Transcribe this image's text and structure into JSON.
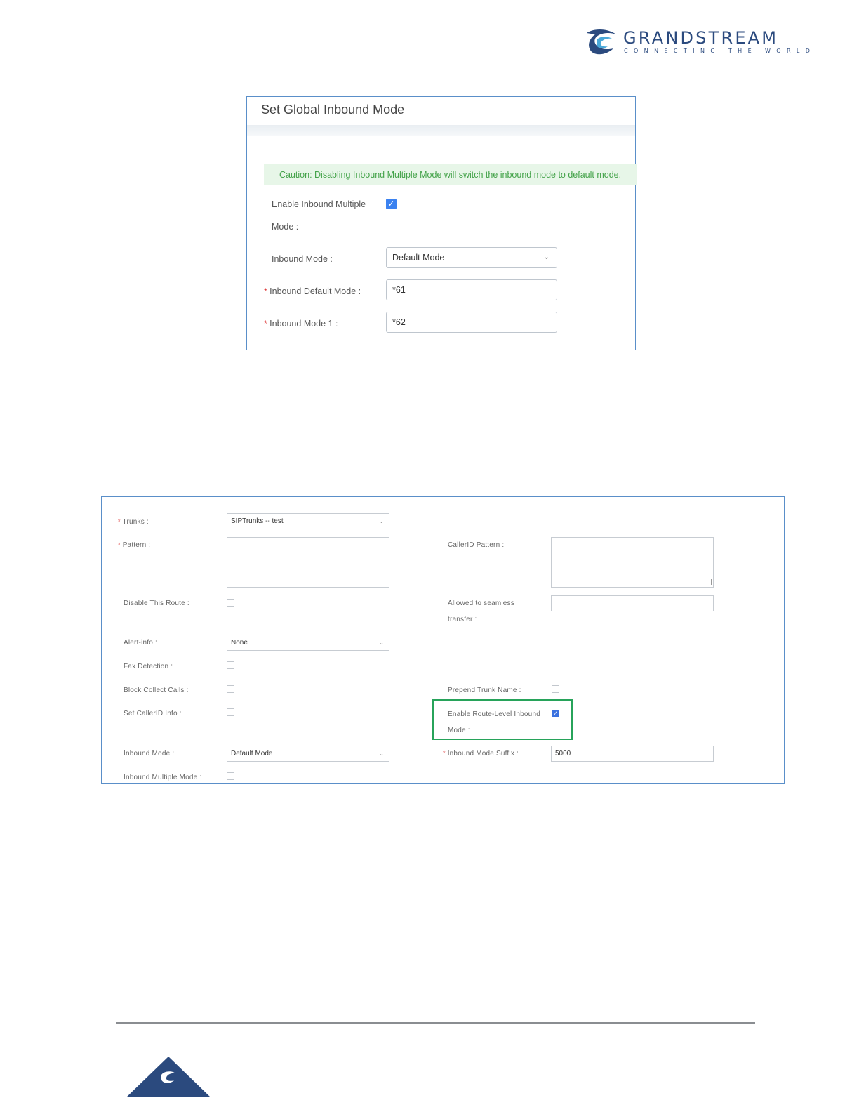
{
  "logo": {
    "name": "GRANDSTREAM",
    "tagline": "CONNECTING THE WORLD",
    "brand_color": "#2b4a7e"
  },
  "global_inbound": {
    "title": "Set Global Inbound Mode",
    "caution": "Caution: Disabling Inbound Multiple Mode will switch the inbound mode to default mode.",
    "enable_multiple_label_line1": "Enable Inbound Multiple",
    "enable_multiple_label_line2": "Mode :",
    "enable_multiple_checked": true,
    "inbound_mode_label": "Inbound Mode :",
    "inbound_mode_value": "Default Mode",
    "default_mode_label": "Inbound Default Mode :",
    "default_mode_value": "*61",
    "mode1_label": "Inbound Mode 1 :",
    "mode1_value": "*62",
    "required_mark": "*"
  },
  "route_form": {
    "required_mark": "*",
    "trunks_label": "Trunks :",
    "trunks_value": "SIPTrunks -- test",
    "pattern_label": "Pattern :",
    "callerid_pattern_label": "CallerID Pattern :",
    "disable_route_label": "Disable This Route :",
    "allowed_seamless_label_line1": "Allowed to seamless",
    "allowed_seamless_label_line2": "transfer :",
    "alert_info_label": "Alert-info :",
    "alert_info_value": "None",
    "fax_detection_label": "Fax Detection :",
    "block_collect_label": "Block Collect Calls :",
    "prepend_trunk_label": "Prepend Trunk Name :",
    "set_callerid_label": "Set CallerID Info :",
    "enable_route_level_line1": "Enable Route-Level Inbound",
    "enable_route_level_line2": "Mode :",
    "enable_route_level_checked": true,
    "inbound_mode_label": "Inbound Mode :",
    "inbound_mode_value": "Default Mode",
    "inbound_mode_suffix_label": "Inbound Mode Suffix :",
    "inbound_mode_suffix_value": "5000",
    "inbound_multiple_label": "Inbound Multiple Mode :",
    "highlight_color": "#27a35a"
  },
  "icons": {
    "checkbox_checked": "✓",
    "dropdown": "chevron-down-icon"
  }
}
